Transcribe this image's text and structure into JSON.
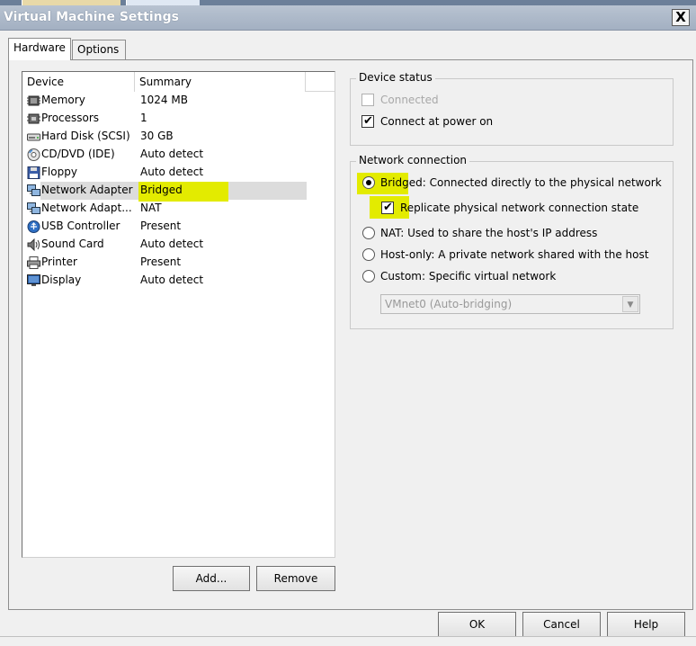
{
  "window": {
    "title": "Virtual Machine Settings",
    "close_glyph": "X"
  },
  "tabs": [
    {
      "label": "Hardware",
      "active": true
    },
    {
      "label": "Options",
      "active": false
    }
  ],
  "device_list": {
    "columns": [
      "Device",
      "Summary"
    ],
    "rows": [
      {
        "icon": "memory-icon",
        "device": "Memory",
        "summary": "1024 MB"
      },
      {
        "icon": "processor-icon",
        "device": "Processors",
        "summary": "1"
      },
      {
        "icon": "hard-disk-icon",
        "device": "Hard Disk (SCSI)",
        "summary": "30 GB"
      },
      {
        "icon": "cd-dvd-icon",
        "device": "CD/DVD (IDE)",
        "summary": "Auto detect"
      },
      {
        "icon": "floppy-icon",
        "device": "Floppy",
        "summary": "Auto detect"
      },
      {
        "icon": "network-adapter-icon",
        "device": "Network Adapter",
        "summary": "Bridged",
        "selected": true
      },
      {
        "icon": "network-adapter-icon",
        "device": "Network Adapt...",
        "summary": "NAT"
      },
      {
        "icon": "usb-icon",
        "device": "USB Controller",
        "summary": "Present"
      },
      {
        "icon": "sound-card-icon",
        "device": "Sound Card",
        "summary": "Auto detect"
      },
      {
        "icon": "printer-icon",
        "device": "Printer",
        "summary": "Present"
      },
      {
        "icon": "display-icon",
        "device": "Display",
        "summary": "Auto detect"
      }
    ]
  },
  "list_buttons": {
    "add": "Add...",
    "remove": "Remove"
  },
  "device_status": {
    "legend": "Device status",
    "connected": {
      "label": "Connected",
      "checked": false,
      "disabled": true
    },
    "connect_at_power_on": {
      "label": "Connect at power on",
      "checked": true
    }
  },
  "network_connection": {
    "legend": "Network connection",
    "bridged": {
      "label": "Bridged: Connected directly to the physical network",
      "selected": true
    },
    "replicate": {
      "label": "Replicate physical network connection state",
      "checked": true
    },
    "nat": {
      "label": "NAT: Used to share the host's IP address",
      "selected": false
    },
    "host_only": {
      "label": "Host-only: A private network shared with the host",
      "selected": false
    },
    "custom": {
      "label": "Custom: Specific virtual network",
      "selected": false
    },
    "vmnet_select": {
      "value": "VMnet0 (Auto-bridging)",
      "disabled": true
    }
  },
  "dialog_buttons": {
    "ok": "OK",
    "cancel": "Cancel",
    "help": "Help"
  },
  "colors": {
    "highlight": "#e3eb00",
    "titlebar": "#a3b0c2",
    "selection": "#dcdcdc"
  }
}
